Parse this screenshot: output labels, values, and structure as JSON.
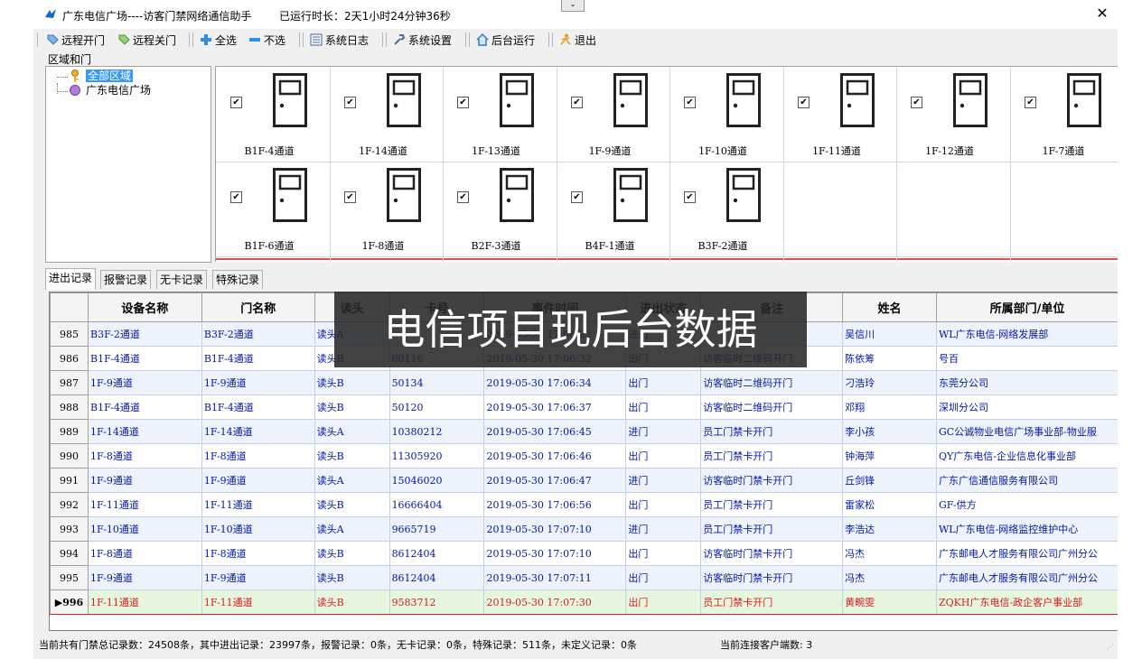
{
  "window": {
    "title": "广东电信广场----访客门禁网络通信助手",
    "uptime": "已运行时长：2天1小时24分钟36秒",
    "close_glyph": "✕",
    "collapse_glyph": "⌄"
  },
  "toolbar": {
    "remote_open": "远程开门",
    "remote_close": "远程关门",
    "select_all": "全选",
    "select_none": "不选",
    "system_log": "系统日志",
    "system_settings": "系统设置",
    "background_run": "后台运行",
    "exit": "退出"
  },
  "area_group_label": "区域和门",
  "tree": {
    "root": "全部区域",
    "child": "广东电信广场"
  },
  "doors": [
    {
      "name": "B1F-4通道",
      "checked": true
    },
    {
      "name": "1F-14通道",
      "checked": true
    },
    {
      "name": "1F-13通道",
      "checked": true
    },
    {
      "name": "1F-9通道",
      "checked": true
    },
    {
      "name": "1F-10通道",
      "checked": true
    },
    {
      "name": "1F-11通道",
      "checked": true
    },
    {
      "name": "1F-12通道",
      "checked": true
    },
    {
      "name": "1F-7通道",
      "checked": true
    },
    {
      "name": "B1F-6通道",
      "checked": true
    },
    {
      "name": "1F-8通道",
      "checked": true
    },
    {
      "name": "B2F-3通道",
      "checked": true
    },
    {
      "name": "B4F-1通道",
      "checked": true
    },
    {
      "name": "B3F-2通道",
      "checked": true
    }
  ],
  "tabs": [
    "进出记录",
    "报警记录",
    "无卡记录",
    "特殊记录"
  ],
  "table": {
    "columns": [
      "设备名称",
      "门名称",
      "读头",
      "卡号",
      "事件时间",
      "进出状态",
      "备注",
      "姓名",
      "所属部门/单位"
    ],
    "rows": [
      {
        "num": "985",
        "cells": [
          "B3F-2通道",
          "B3F-2通道",
          "读头A",
          "",
          "2019-05-30 17:06:22",
          "进门",
          "",
          "吴信川",
          "WL广东电信-网络发展部"
        ]
      },
      {
        "num": "986",
        "cells": [
          "B1F-4通道",
          "B1F-4通道",
          "读头B",
          "60116",
          "2019-05-30 17:06:32",
          "出门",
          "访客临时二维码开门",
          "陈依筹",
          "号百"
        ]
      },
      {
        "num": "987",
        "cells": [
          "1F-9通道",
          "1F-9通道",
          "读头B",
          "50134",
          "2019-05-30 17:06:34",
          "出门",
          "访客临时二维码开门",
          "刁浩玲",
          "东莞分公司"
        ]
      },
      {
        "num": "988",
        "cells": [
          "B1F-4通道",
          "B1F-4通道",
          "读头B",
          "50120",
          "2019-05-30 17:06:37",
          "出门",
          "访客临时二维码开门",
          "邓翔",
          "深圳分公司"
        ]
      },
      {
        "num": "989",
        "cells": [
          "1F-14通道",
          "1F-14通道",
          "读头A",
          "10380212",
          "2019-05-30 17:06:45",
          "进门",
          "员工门禁卡开门",
          "李小孩",
          "GC公诚物业电信广场事业部-物业服"
        ]
      },
      {
        "num": "990",
        "cells": [
          "1F-8通道",
          "1F-8通道",
          "读头B",
          "11305920",
          "2019-05-30 17:06:46",
          "出门",
          "员工门禁卡开门",
          "钟海萍",
          "QY广东电信-企业信息化事业部"
        ]
      },
      {
        "num": "991",
        "cells": [
          "1F-9通道",
          "1F-9通道",
          "读头A",
          "15046020",
          "2019-05-30 17:06:47",
          "进门",
          "访客临时门禁卡开门",
          "丘剑锋",
          "广东广信通信服务有限公司"
        ]
      },
      {
        "num": "992",
        "cells": [
          "1F-11通道",
          "1F-11通道",
          "读头B",
          "16666404",
          "2019-05-30 17:06:56",
          "出门",
          "员工门禁卡开门",
          "雷家松",
          "GF-供方"
        ]
      },
      {
        "num": "993",
        "cells": [
          "1F-10通道",
          "1F-10通道",
          "读头A",
          "9665719",
          "2019-05-30 17:07:10",
          "进门",
          "员工门禁卡开门",
          "李浩达",
          "WL广东电信-网络监控维护中心"
        ]
      },
      {
        "num": "994",
        "cells": [
          "1F-8通道",
          "1F-8通道",
          "读头B",
          "8612404",
          "2019-05-30 17:07:10",
          "出门",
          "访客临时门禁卡开门",
          "冯杰",
          "广东邮电人才服务有限公司广州分公"
        ]
      },
      {
        "num": "995",
        "cells": [
          "1F-9通道",
          "1F-9通道",
          "读头B",
          "8612404",
          "2019-05-30 17:07:11",
          "出门",
          "访客临时门禁卡开门",
          "冯杰",
          "广东邮电人才服务有限公司广州分公"
        ]
      },
      {
        "num": "▶996",
        "cells": [
          "1F-11通道",
          "1F-11通道",
          "读头B",
          "9583712",
          "2019-05-30 17:07:30",
          "出门",
          "员工门禁卡开门",
          "黄畹雯",
          "ZQKH广东电信-政企客户事业部"
        ]
      }
    ]
  },
  "status": {
    "summary": "当前共有门禁总记录数：24508条，其中进出记录：23997条，报警记录：0条，无卡记录：0条，特殊记录：511条，未定义记录：0条",
    "clients": "当前连接客户端数: 3"
  },
  "overlay_caption": "电信项目现后台数据"
}
